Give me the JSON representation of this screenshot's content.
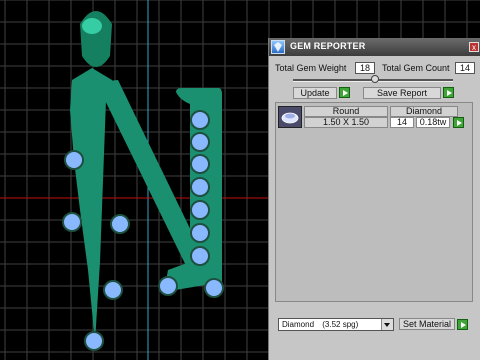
{
  "panel": {
    "title": "GEM REPORTER",
    "close_label": "x",
    "total_gem_weight_label": "Total Gem Weight",
    "total_gem_weight_value": "18",
    "total_gem_count_label": "Total Gem Count",
    "total_gem_count_value": "14",
    "update_label": "Update",
    "save_report_label": "Save Report",
    "table": {
      "row": {
        "shape": "Round",
        "size": "1.50 X 1.50",
        "material": "Diamond",
        "count": "14",
        "weight": "0.18tw"
      }
    },
    "material_select": {
      "value": "Diamond",
      "spec": "(3.52 spg)"
    },
    "set_material_label": "Set Material"
  },
  "colors": {
    "background": "#000000",
    "grid": "#4a4a4a",
    "model_green": "#1a9070",
    "gem_blue": "#8ab8ff",
    "axis_red": "#c01010",
    "axis_cyan": "#3aa6c0",
    "go_green": "#3fa536"
  },
  "icons": {
    "app": "gem-reporter-app-icon",
    "close": "close-icon",
    "go": "play-arrow-icon",
    "thumbnail": "round-gem-thumbnail",
    "dropdown": "chevron-down-icon"
  }
}
